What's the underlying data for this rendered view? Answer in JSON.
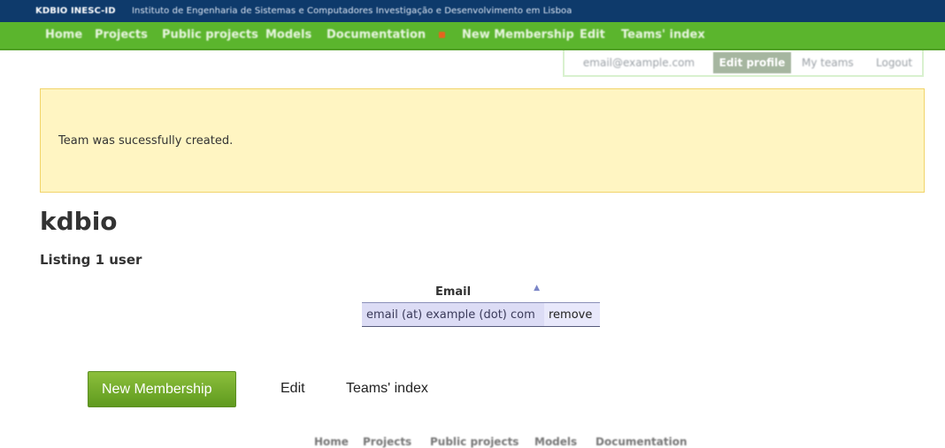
{
  "top_bar": {
    "org": "KDBIO INESC-ID",
    "institute": "Instituto de Engenharia de Sistemas e Computadores Investigação e Desenvolvimento em Lisboa"
  },
  "main_nav": {
    "items": [
      "Home",
      "Projects",
      "Public projects",
      "Models",
      "Documentation",
      "New Membership",
      "Edit",
      "Teams' index"
    ],
    "separator_icon": "orange-square-bullet-icon"
  },
  "user_menu": {
    "email": "email@example.com",
    "edit_profile": "Edit profile",
    "my_teams": "My teams",
    "logout": "Logout"
  },
  "flash": {
    "message": "Team was sucessfully created."
  },
  "team": {
    "name": "kdbio",
    "listing": "Listing 1 user"
  },
  "users_table": {
    "header_email": "Email",
    "sort_icon": "sort-ascending-triangle-icon",
    "rows": [
      {
        "email": "email (at) example (dot) com",
        "action": "remove"
      }
    ]
  },
  "actions": {
    "new_membership": "New Membership",
    "edit": "Edit",
    "teams_index": "Teams' index"
  },
  "footer_nav": {
    "items": [
      "Home",
      "Projects",
      "Public projects",
      "Models",
      "Documentation"
    ]
  },
  "colors": {
    "top_bar": "#0e3a6b",
    "nav_green": "#5bb52d",
    "flash_bg": "#fff5c2",
    "flash_border": "#f1d46a",
    "button_green": "#6ea62a",
    "table_row": "#dcdcf5"
  }
}
